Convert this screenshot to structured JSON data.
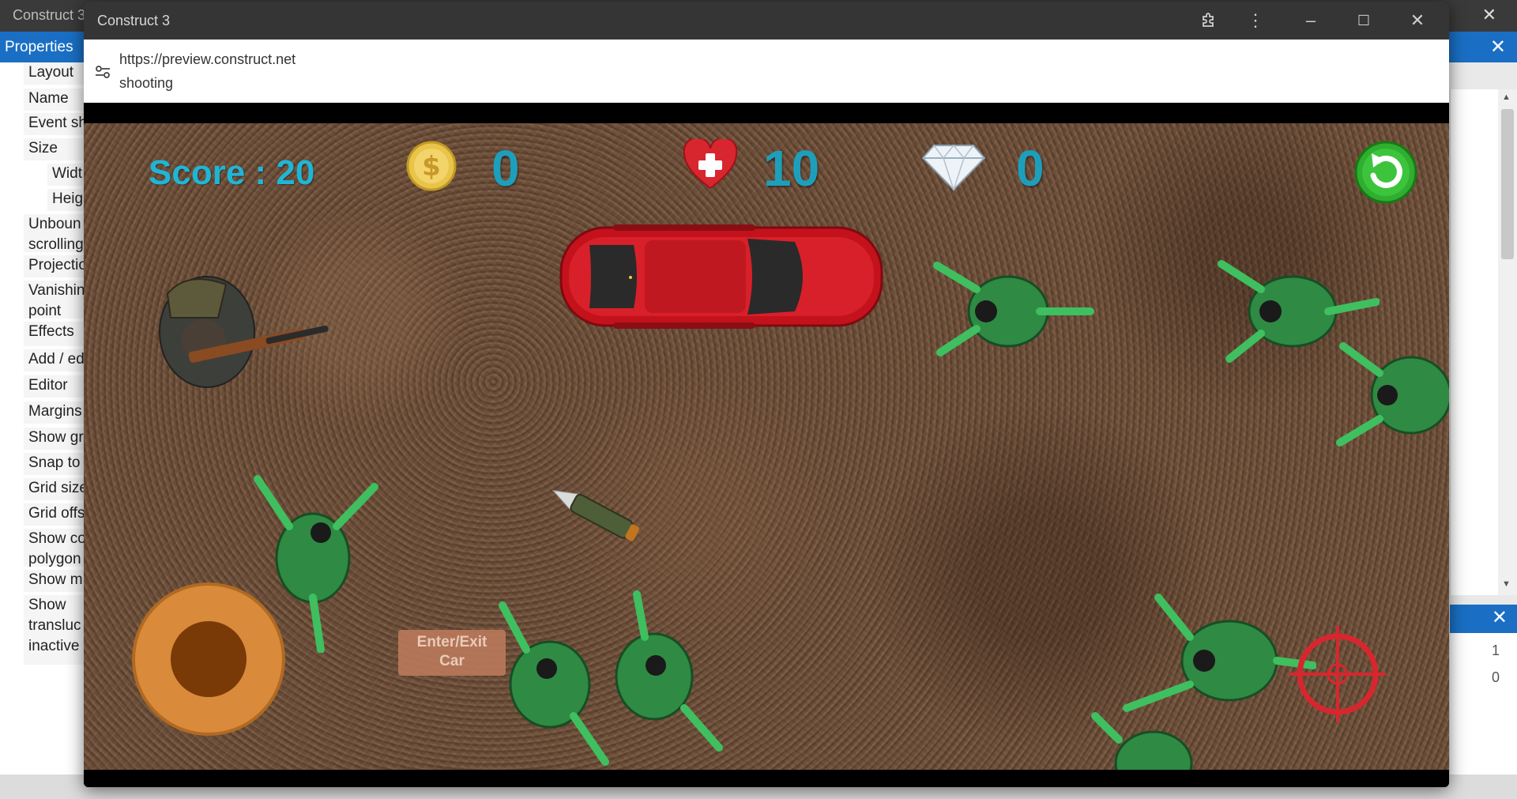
{
  "editor": {
    "app_title": "Construct 3",
    "properties_title": "Properties",
    "property_rows": [
      {
        "label": "Layout"
      },
      {
        "label": "Name"
      },
      {
        "label": "Event sh"
      },
      {
        "label": "Size"
      },
      {
        "label": "Widt"
      },
      {
        "label": "Heig"
      },
      {
        "label": "Unboun\nscrolling"
      },
      {
        "label": "Projectio"
      },
      {
        "label": "Vanishin\npoint"
      },
      {
        "label": "Effects"
      },
      {
        "label": "Add / ed"
      },
      {
        "label": "Editor"
      },
      {
        "label": "Margins"
      },
      {
        "label": "Show gr"
      },
      {
        "label": "Snap to"
      },
      {
        "label": "Grid size"
      },
      {
        "label": "Grid offs"
      },
      {
        "label": "Show co\npolygon"
      },
      {
        "label": "Show m"
      },
      {
        "label": "Show\ntransluc\ninactive"
      }
    ],
    "right_values": [
      "1",
      "0"
    ]
  },
  "preview_window": {
    "title": "Construct 3",
    "url": "https://preview.construct.net",
    "page_title": "shooting",
    "icons": [
      "extension-icon",
      "more-vert-icon",
      "minimize-icon",
      "maximize-icon",
      "close-icon"
    ]
  },
  "game": {
    "score_text": "Score : 20",
    "coins": "0",
    "health": "10",
    "diamonds": "0",
    "enter_exit_button": "Enter/Exit\nCar",
    "colors": {
      "score": "#1fb6d6",
      "counter": "#1d9fbc",
      "joystick": "#d98a3a",
      "crosshair": "#d8262e",
      "car": "#c4121c",
      "zombie": "#3fbf5f"
    }
  }
}
